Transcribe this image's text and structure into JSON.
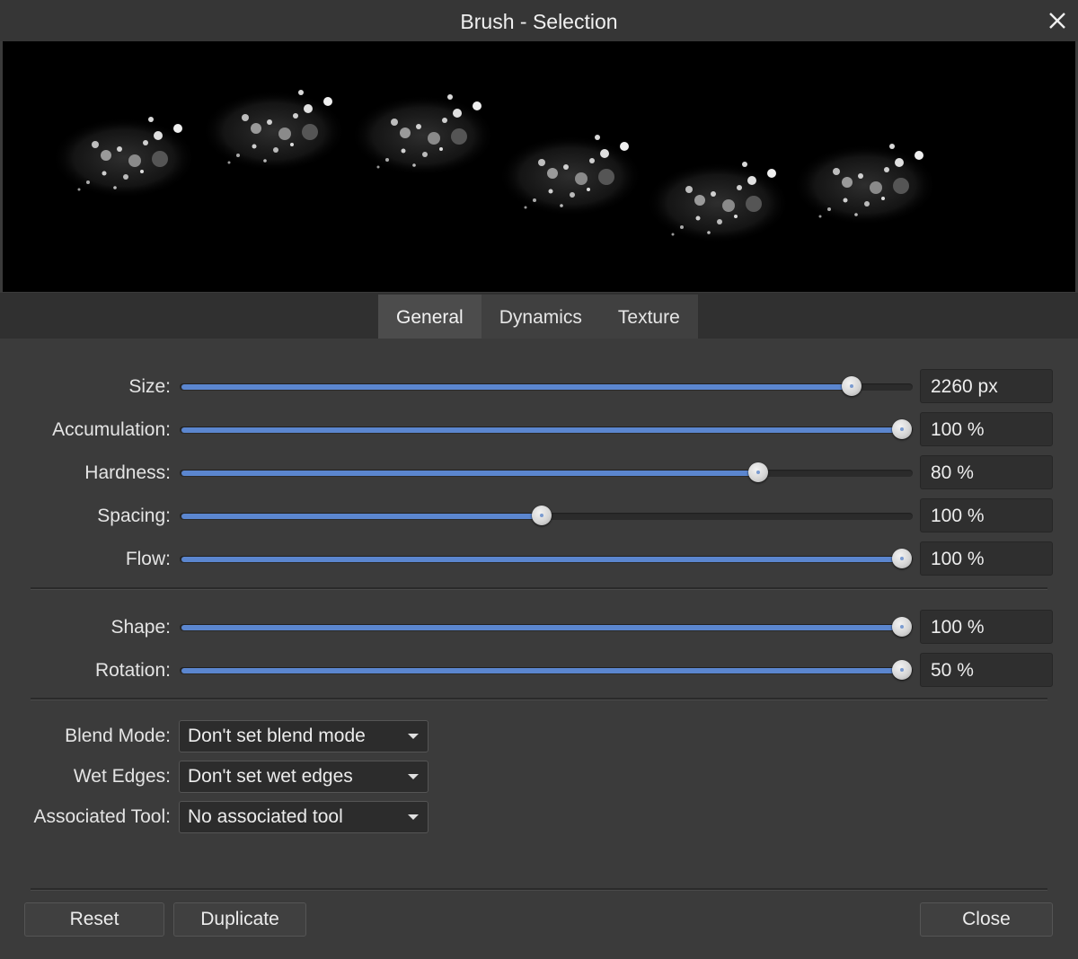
{
  "window": {
    "title": "Brush - Selection",
    "close_icon": "close-icon"
  },
  "tabs": [
    {
      "label": "General",
      "active": true
    },
    {
      "label": "Dynamics",
      "active": false
    },
    {
      "label": "Texture",
      "active": false
    }
  ],
  "sliders": [
    {
      "label": "Size:",
      "value": "2260 px",
      "fraction": 0.93
    },
    {
      "label": "Accumulation:",
      "value": "100 %",
      "fraction": 1.0
    },
    {
      "label": "Hardness:",
      "value": "80 %",
      "fraction": 0.8
    },
    {
      "label": "Spacing:",
      "value": "100 %",
      "fraction": 0.5
    },
    {
      "label": "Flow:",
      "value": "100 %",
      "fraction": 1.0
    },
    {
      "label": "Shape:",
      "value": "100 %",
      "fraction": 1.0
    },
    {
      "label": "Rotation:",
      "value": "50 %",
      "fraction": 1.0
    }
  ],
  "dropdowns": [
    {
      "label": "Blend Mode:",
      "value": "Don't set blend mode"
    },
    {
      "label": "Wet Edges:",
      "value": "Don't set wet edges"
    },
    {
      "label": "Associated Tool:",
      "value": "No associated tool"
    }
  ],
  "buttons": {
    "reset": "Reset",
    "duplicate": "Duplicate",
    "close": "Close"
  },
  "colors": {
    "accent": "#5b86cf",
    "background": "#3b3b3b",
    "preview_bg": "#000000"
  }
}
